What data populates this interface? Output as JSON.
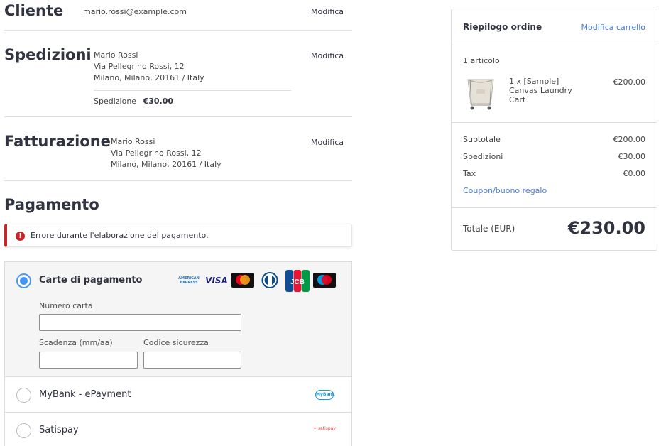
{
  "customer": {
    "title": "Cliente",
    "email": "mario.rossi@example.com",
    "edit_label": "Modifica"
  },
  "shipping": {
    "title": "Spedizioni",
    "address": [
      "Mario Rossi",
      "Via Pellegrino Rossi, 12",
      "Milano, Milano, 20161 / Italy"
    ],
    "method_label": "Spedizione",
    "method_price": "€30.00",
    "edit_label": "Modifica"
  },
  "billing": {
    "title": "Fatturazione",
    "address": [
      "Mario Rossi",
      "Via Pellegrino Rossi, 12",
      "Milano, Milano, 20161 / Italy"
    ],
    "edit_label": "Modifica"
  },
  "payment": {
    "title": "Pagamento",
    "error_message": "Errore durante l'elaborazione del pagamento.",
    "methods": [
      {
        "label": "Carte di pagamento",
        "selected": true
      },
      {
        "label": "MyBank - ePayment",
        "selected": false
      },
      {
        "label": "Satispay",
        "selected": false
      }
    ],
    "card_logos": [
      "AMERICAN EXPRESS",
      "VISA",
      "mastercard",
      "Diners Club",
      "JCB",
      "maestro"
    ],
    "fields": {
      "card_number_label": "Numero carta",
      "expiry_label": "Scadenza (mm/aa)",
      "cvv_label": "Codice sicurezza"
    },
    "mybank_logo": "MyBank",
    "satispay_logo": "satispay"
  },
  "summary": {
    "title": "Riepilogo ordine",
    "edit_cart": "Modifica carrello",
    "item_count": "1 articolo",
    "item": {
      "name": "1 x [Sample] Canvas Laundry Cart",
      "price": "€200.00"
    },
    "rows": [
      {
        "label": "Subtotale",
        "value": "€200.00"
      },
      {
        "label": "Spedizioni",
        "value": "€30.00"
      },
      {
        "label": "Tax",
        "value": "€0.00"
      }
    ],
    "coupon_link": "Coupon/buono regalo",
    "total_label": "Totale (EUR)",
    "total_value": "€230.00"
  },
  "colors": {
    "accent": "#4496f6",
    "link": "#4a7ad6",
    "error": "#c9242a",
    "text": "#313440"
  }
}
